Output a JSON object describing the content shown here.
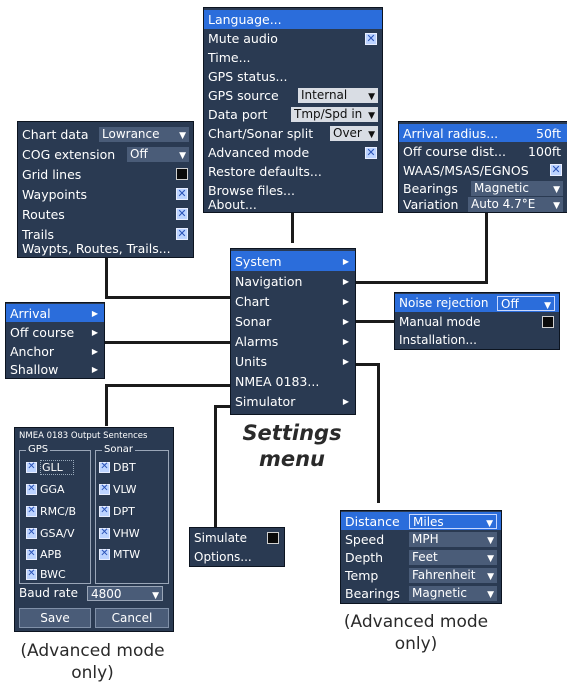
{
  "title": "Settings menu",
  "settings_menu": {
    "items": [
      {
        "label": "System"
      },
      {
        "label": "Navigation"
      },
      {
        "label": "Chart"
      },
      {
        "label": "Sonar"
      },
      {
        "label": "Alarms"
      },
      {
        "label": "Units"
      },
      {
        "label": "NMEA 0183..."
      },
      {
        "label": "Simulator"
      }
    ]
  },
  "system_menu": {
    "language": "Language...",
    "mute_audio": "Mute audio",
    "time": "Time...",
    "gps_status": "GPS status...",
    "gps_source": {
      "label": "GPS source",
      "value": "Internal"
    },
    "data_port": {
      "label": "Data port",
      "value": "Tmp/Spd in"
    },
    "split": {
      "label": "Chart/Sonar split",
      "value": "Over"
    },
    "advanced_mode": "Advanced mode",
    "restore_defaults": "Restore defaults...",
    "browse_files": "Browse files...",
    "about": "About..."
  },
  "chart_menu": {
    "chart_data": {
      "label": "Chart data",
      "value": "Lowrance"
    },
    "cog_extension": {
      "label": "COG extension",
      "value": "Off"
    },
    "grid_lines": "Grid lines",
    "waypoints": "Waypoints",
    "routes": "Routes",
    "trails": "Trails",
    "wrt": "Waypts, Routes, Trails..."
  },
  "navigation_menu": {
    "arrival_radius": {
      "label": "Arrival radius...",
      "value": "50ft"
    },
    "off_course": {
      "label": "Off course dist...",
      "value": "100ft"
    },
    "waas": "WAAS/MSAS/EGNOS",
    "bearings": {
      "label": "Bearings",
      "value": "Magnetic"
    },
    "variation": {
      "label": "Variation",
      "value": "Auto 4.7°E"
    }
  },
  "alarms_menu": {
    "items": [
      {
        "label": "Arrival"
      },
      {
        "label": "Off course"
      },
      {
        "label": "Anchor"
      },
      {
        "label": "Shallow"
      }
    ]
  },
  "sonar_menu": {
    "noise_rejection": {
      "label": "Noise rejection",
      "value": "Off"
    },
    "manual_mode": "Manual mode",
    "installation": "Installation..."
  },
  "nmea_dialog": {
    "header": "NMEA 0183 Output Sentences",
    "gps_group": "GPS",
    "sonar_group": "Sonar",
    "gps_items": [
      "GLL",
      "GGA",
      "RMC/B",
      "GSA/V",
      "APB",
      "BWC"
    ],
    "sonar_items": [
      "DBT",
      "VLW",
      "DPT",
      "VHW",
      "MTW"
    ],
    "baud_label": "Baud rate",
    "baud_value": "4800",
    "save": "Save",
    "cancel": "Cancel"
  },
  "simulator_menu": {
    "simulate": "Simulate",
    "options": "Options..."
  },
  "units_menu": {
    "distance": {
      "label": "Distance",
      "value": "Miles"
    },
    "speed": {
      "label": "Speed",
      "value": "MPH"
    },
    "depth": {
      "label": "Depth",
      "value": "Feet"
    },
    "temp": {
      "label": "Temp",
      "value": "Fahrenheit"
    },
    "bearings": {
      "label": "Bearings",
      "value": "Magnetic"
    }
  },
  "captions": {
    "left": "(Advanced mode only)",
    "right": "(Advanced mode only)"
  },
  "icons": {
    "check": "checkbox-checked-icon",
    "arrow": "dropdown-arrow-icon",
    "submenu": "submenu-arrow-icon"
  },
  "colors": {
    "panel": "#2a3a52",
    "highlight": "#2b6ddb",
    "text": "#ffffff"
  }
}
